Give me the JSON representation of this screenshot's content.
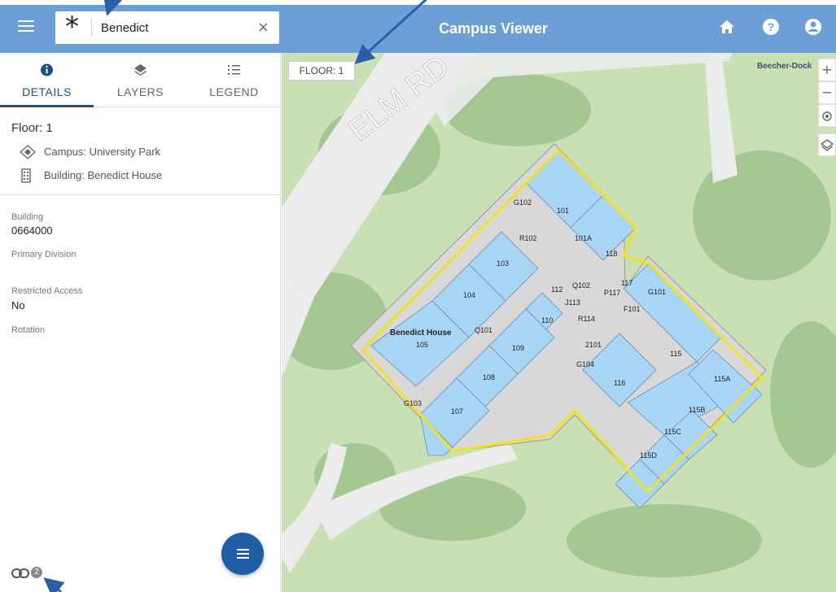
{
  "header": {
    "title": "Campus Viewer",
    "search_value": "Benedict",
    "search_clear": "×",
    "background_color": "#6c9fd6"
  },
  "tabs": [
    {
      "label": "DETAILS",
      "icon": "info-circle-icon",
      "active": true
    },
    {
      "label": "LAYERS",
      "icon": "layers-icon",
      "active": false
    },
    {
      "label": "LEGEND",
      "icon": "list-icon",
      "active": false
    }
  ],
  "details": {
    "floor_heading": "Floor: 1",
    "campus": "Campus: University Park",
    "building": "Building: Benedict House",
    "attributes": [
      {
        "label": "Building",
        "value": "0664000"
      },
      {
        "label": "Primary Division",
        "value": ""
      },
      {
        "label": "Restricted Access",
        "value": "No"
      },
      {
        "label": "Rotation",
        "value": ""
      }
    ]
  },
  "footer": {
    "link_count": "2"
  },
  "map": {
    "floor_badge": "FLOOR: 1",
    "street_label": "ELM RD",
    "dock_label": "Beecher-Dock",
    "building_label": "Benedict House",
    "zoom_in": "+",
    "zoom_out": "−",
    "rooms": [
      "101",
      "101A",
      "118",
      "R102",
      "G102",
      "103",
      "104",
      "105",
      "Q101",
      "109",
      "110",
      "112",
      "Q102",
      "J113",
      "R114",
      "P117",
      "117",
      "G101",
      "F101",
      "108",
      "107",
      "G103",
      "G104",
      "2101",
      "116",
      "115",
      "115A",
      "115B",
      "115C",
      "115D"
    ],
    "colors": {
      "grass": "#c9dfb4",
      "trees": "#9fc48c",
      "room_fill": "#a9d6f5",
      "outline": "#f2e419",
      "corridor": "#d8d8d8"
    }
  },
  "accent_color": "#1f4e85"
}
